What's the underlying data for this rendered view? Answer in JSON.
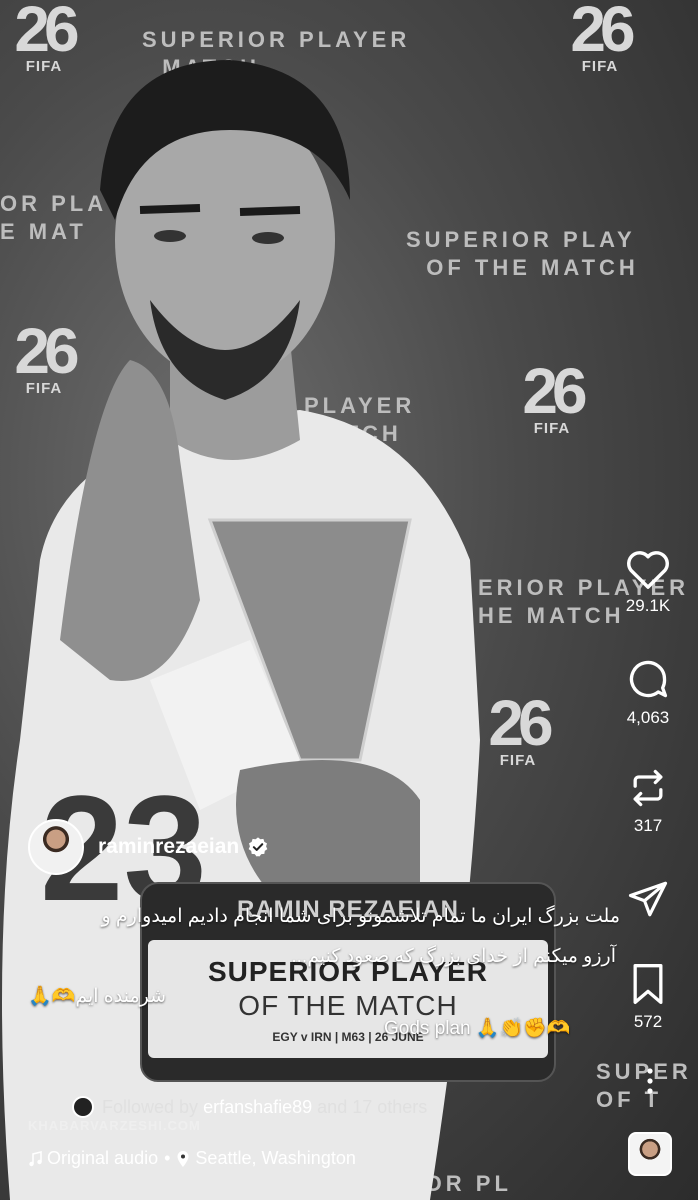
{
  "post": {
    "background_texts": {
      "top": "SUPERIOR PLAYER\n  MATCH",
      "mid_right": "SUPERIOR PLAY\n  OF THE MATCH",
      "left": "OR PLAY\nE MAT",
      "center": "PLAYER\nMATCH",
      "lower_right": "ERIOR PLAYER\nHE MATCH",
      "bottom_right": "SUPER\nOF T",
      "bottom_center": "ERIOR PL"
    },
    "logo": {
      "number": "26",
      "brand": "FIFA"
    },
    "plate": {
      "name": "RAMIN REZAEIAN",
      "title": "SUPERIOR PLAYER",
      "subtitle": "OF THE MATCH",
      "meta": "EGY v IRN  |  M63  |  26 JUNE"
    },
    "jersey_number": "23"
  },
  "actions": {
    "like": {
      "icon": "heart-icon",
      "count": "29.1K"
    },
    "comment": {
      "icon": "comment-icon",
      "count": "4,063"
    },
    "repost": {
      "icon": "repost-icon",
      "count": "317"
    },
    "share": {
      "icon": "send-icon"
    },
    "save": {
      "icon": "bookmark-icon",
      "count": "572"
    },
    "more": {
      "icon": "more-vertical-icon"
    }
  },
  "author": {
    "username": "raminrezaeian",
    "verified": true
  },
  "caption": {
    "line1": "ملت بزرگ ایران ما تمام تلاشمونو برای شما انجام دادیم امیدوارم و",
    "line2": "آرزو میکنم از خدای بزرگ که صعود کنیم...",
    "line3": "شرمنده ایم🫶🙏",
    "line4": "Gods plan 🙏👏✊🫶"
  },
  "followed_by": {
    "prefix": "Followed by",
    "user": "erfanshafie89",
    "suffix": "and 17 others"
  },
  "location": {
    "audio_label": "Original audio",
    "place": "Seattle, Washington"
  },
  "watermark": "KHABARVARZESHI.COM",
  "colors": {
    "text": "#ffffff",
    "background": "#3a3a3a"
  }
}
